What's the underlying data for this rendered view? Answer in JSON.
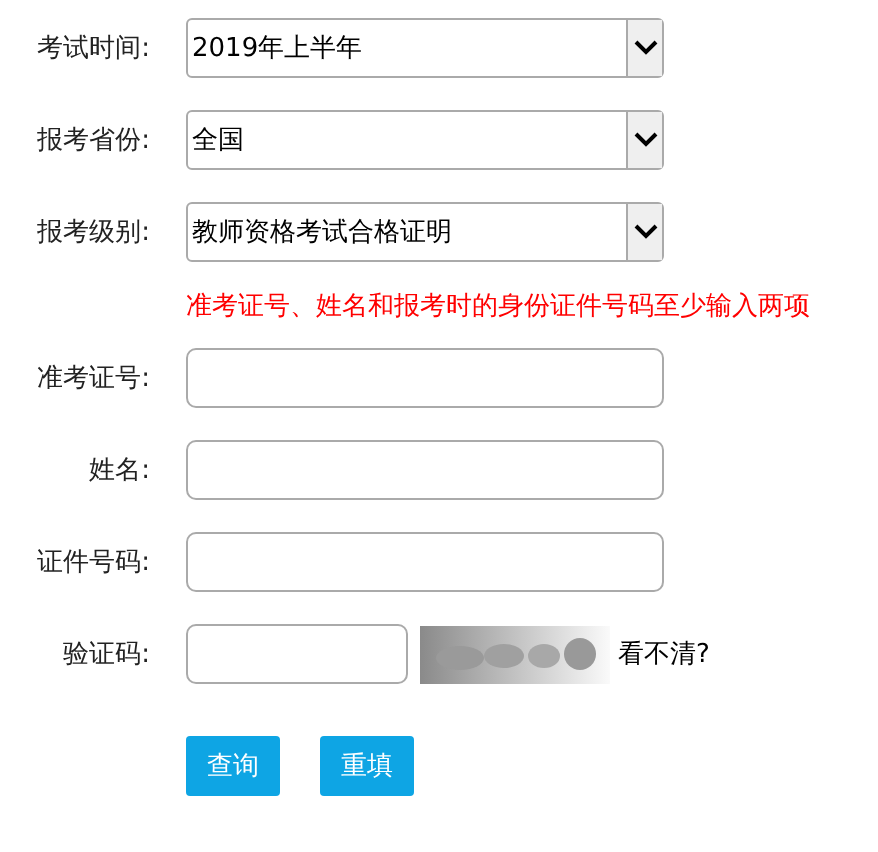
{
  "selects": [
    {
      "label": "考试时间:",
      "value": "2019年上半年"
    },
    {
      "label": "报考省份:",
      "value": "全国"
    },
    {
      "label": "报考级别:",
      "value": "教师资格考试合格证明"
    }
  ],
  "note": "准考证号、姓名和报考时的身份证件号码至少输入两项",
  "inputs": [
    {
      "label": "准考证号:"
    },
    {
      "label": "姓名:"
    },
    {
      "label": "证件号码:"
    }
  ],
  "captcha": {
    "label": "验证码:",
    "refresh_link": "看不清?"
  },
  "buttons": [
    "查询",
    "重填"
  ]
}
